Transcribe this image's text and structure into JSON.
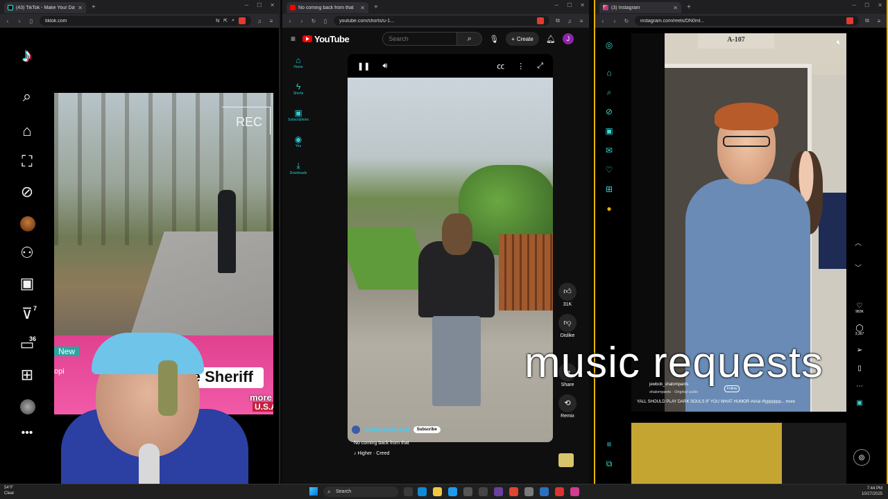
{
  "tiktok": {
    "tab_title": "(43) TikTok - Make Your Day",
    "url": "tiktok.com",
    "badges": {
      "following": "7",
      "messages": "36"
    },
    "video": {
      "rec_label": "REC",
      "banner_new": "New",
      "banner_topic": "opi",
      "headline": "the Sheriff",
      "more_label": "more",
      "tag": "U.S.A"
    },
    "colors": {
      "brand": "#fe2c55",
      "accent": "#25f4ee"
    }
  },
  "youtube": {
    "tab_title": "No coming back from that",
    "url": "youtube.com/shorts/u-1...",
    "logo": "YouTube",
    "search_placeholder": "Search",
    "create_label": "Create",
    "avatar_letter": "J",
    "sidebar": [
      {
        "icon": "home-icon",
        "label": "Home"
      },
      {
        "icon": "shorts-icon",
        "label": "Shorts"
      },
      {
        "icon": "subscriptions-icon",
        "label": "Subscriptions"
      },
      {
        "icon": "you-icon",
        "label": "You"
      },
      {
        "icon": "downloads-icon",
        "label": "Downloads"
      }
    ],
    "actions": {
      "like_count": "31K",
      "dislike_label": "Dislike",
      "share_label": "Share",
      "remix_label": "Remix"
    },
    "channel": "@swag-on-the-beat",
    "subscribe_label": "Subscribe",
    "video_title": "No coming back from that",
    "song": "♪ Higher · Creed",
    "colors": {
      "brand": "#ff0000",
      "link": "#3ad0ff"
    }
  },
  "instagram": {
    "tab_title": "(3) Instagram",
    "url": "instagram.com/reels/DN0mI...",
    "sign_text": "A-107",
    "user": "jewbob_shalompants",
    "audio": "shalompants · Original audio",
    "follow_label": "Follow",
    "caption": "YALL SHOULD PLAY DARK SOULS IF YOU WHAT HUMOR #viral #fypppppp... more",
    "likes": "983K",
    "comments": "3,367",
    "colors": {
      "accent": "#38d9d2",
      "border": "#e9b400"
    }
  },
  "overlay_text": "music requests",
  "taskbar": {
    "weather_temp": "54°F",
    "weather_desc": "Clear",
    "search_placeholder": "Search",
    "time": "7:44 PM",
    "date": "10/27/2025"
  }
}
